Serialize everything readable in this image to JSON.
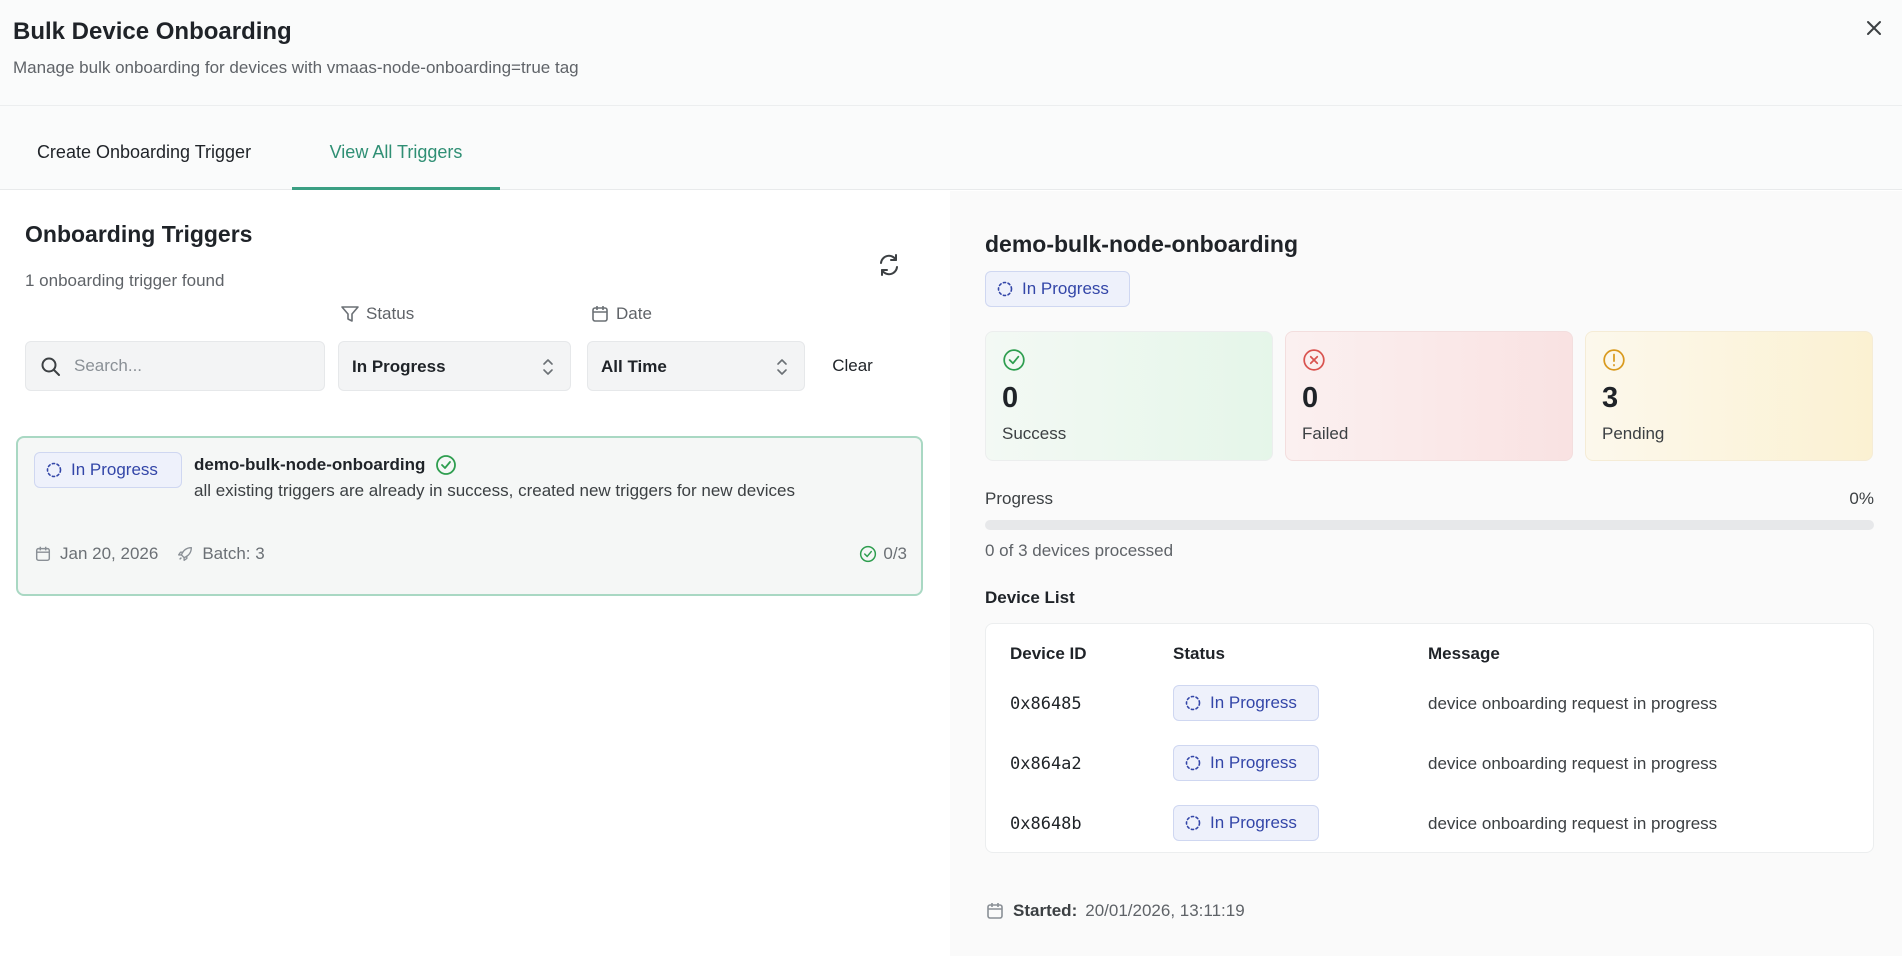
{
  "header": {
    "title": "Bulk Device Onboarding",
    "subtitle": "Manage bulk onboarding for devices with vmaas-node-onboarding=true tag"
  },
  "tabs": [
    {
      "label": "Create Onboarding Trigger",
      "active": false
    },
    {
      "label": "View All Triggers",
      "active": true
    }
  ],
  "left": {
    "title": "Onboarding Triggers",
    "count_text": "1 onboarding trigger found",
    "filters": {
      "search_placeholder": "Search...",
      "status_label": "Status",
      "status_value": "In Progress",
      "date_label": "Date",
      "date_value": "All Time",
      "clear_label": "Clear"
    },
    "triggers": [
      {
        "status": "In Progress",
        "name": "demo-bulk-node-onboarding",
        "description": "all existing triggers are already in success, created new triggers for new devices",
        "date": "Jan 20, 2026",
        "batch": "Batch: 3",
        "progress": "0/3"
      }
    ]
  },
  "detail": {
    "title": "demo-bulk-node-onboarding",
    "status": "In Progress",
    "stats": {
      "success": {
        "value": "0",
        "label": "Success"
      },
      "failed": {
        "value": "0",
        "label": "Failed"
      },
      "pending": {
        "value": "3",
        "label": "Pending"
      }
    },
    "progress_label": "Progress",
    "progress_percent": "0%",
    "progress_fraction": 0,
    "progress_text": "0 of 3 devices processed",
    "device_list_title": "Device List",
    "columns": [
      "Device ID",
      "Status",
      "Message"
    ],
    "devices": [
      {
        "id": "0x86485",
        "status": "In Progress",
        "message": "device onboarding request in progress"
      },
      {
        "id": "0x864a2",
        "status": "In Progress",
        "message": "device onboarding request in progress"
      },
      {
        "id": "0x8648b",
        "status": "In Progress",
        "message": "device onboarding request in progress"
      }
    ],
    "started_label": "Started:",
    "started_value": "20/01/2026, 13:11:19"
  },
  "colors": {
    "accent": "#3b9f83",
    "badge_text": "#3346a8",
    "success": "#2e9e4f",
    "failed": "#d9534f",
    "pending": "#d99a1e"
  },
  "icons": [
    "close-icon",
    "refresh-icon",
    "search-icon",
    "filter-icon",
    "calendar-icon",
    "chevron-updown-icon",
    "spinner-icon",
    "check-circle-icon",
    "x-circle-icon",
    "alert-circle-icon",
    "rocket-icon"
  ]
}
